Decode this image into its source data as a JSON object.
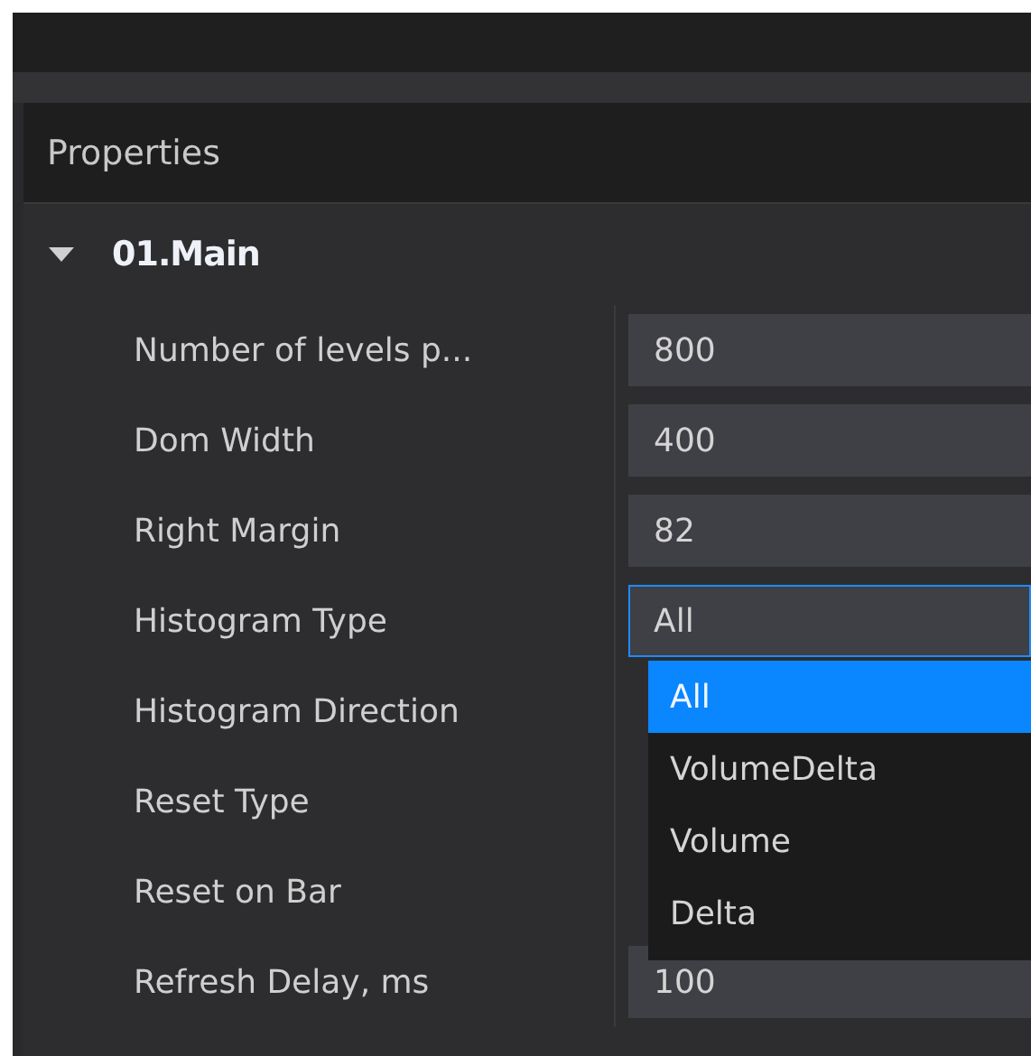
{
  "panel": {
    "title": "Properties"
  },
  "group": {
    "name": "01.Main",
    "expanded": true,
    "rows": [
      {
        "label": "Number of levels p...",
        "value": "800",
        "focused": false
      },
      {
        "label": "Dom Width",
        "value": "400",
        "focused": false
      },
      {
        "label": "Right Margin",
        "value": "82",
        "focused": false
      },
      {
        "label": "Histogram Type",
        "value": "All",
        "focused": true,
        "options": [
          {
            "label": "All",
            "selected": true
          },
          {
            "label": "VolumeDelta",
            "selected": false
          },
          {
            "label": "Volume",
            "selected": false
          },
          {
            "label": "Delta",
            "selected": false
          }
        ]
      },
      {
        "label": "Histogram Direction"
      },
      {
        "label": "Reset Type"
      },
      {
        "label": "Reset on Bar"
      },
      {
        "label": "Refresh Delay, ms",
        "value": "100",
        "focused": false
      }
    ]
  }
}
